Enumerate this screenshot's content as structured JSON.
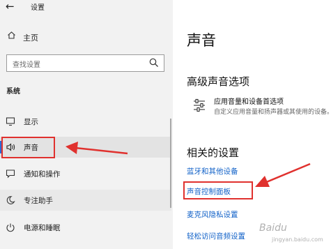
{
  "window": {
    "title": "设置",
    "back_icon": "back-arrow-icon"
  },
  "sidebar": {
    "home": {
      "label": "主页",
      "icon": "home-icon"
    },
    "search": {
      "placeholder": "查找设置",
      "icon": "search-icon"
    },
    "section_label": "系统",
    "items": [
      {
        "label": "显示",
        "icon": "display-icon"
      },
      {
        "label": "声音",
        "icon": "speaker-icon",
        "selected": true
      },
      {
        "label": "通知和操作",
        "icon": "notification-icon"
      },
      {
        "label": "专注助手",
        "icon": "moon-icon"
      },
      {
        "label": "电源和睡眠",
        "icon": "power-icon"
      }
    ]
  },
  "main": {
    "title": "声音",
    "advanced": {
      "heading": "高级声音选项",
      "item": {
        "title": "应用音量和设备首选项",
        "description": "自定义应用音量和扬声器或其使用的设备。",
        "icon": "sliders-icon"
      }
    },
    "related": {
      "heading": "相关的设置",
      "links": [
        "蓝牙和其他设备",
        "声音控制面板",
        "麦克风隐私设置",
        "轻松访问音频设置"
      ]
    }
  },
  "annotations": {
    "highlight_color": "#e0312e"
  },
  "watermark": {
    "line1": "Baidu",
    "line2": "jingyan.baidu.com"
  },
  "colors": {
    "accent": "#1262c8",
    "selected_bar": "#2b6ad5"
  }
}
